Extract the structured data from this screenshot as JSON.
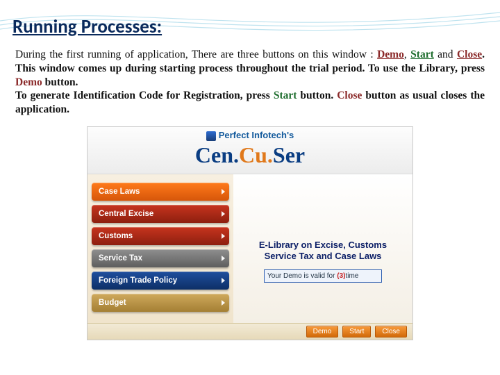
{
  "heading": "Running Processes:",
  "para": {
    "seg1": "During the first running of application, There are three buttons on this window : ",
    "demo": "Demo",
    "comma": ", ",
    "start": "Start",
    "and": " and ",
    "close": "Close",
    "seg2": ".  This window comes up during starting process throughout the trial period.  To use the Library, press ",
    "demo2": "Demo",
    "seg3": " button.",
    "line2a": "To generate Identification Code for Registration, press ",
    "start2": "Start",
    "line2b": " button. ",
    "close2": "Close",
    "line2c": " button as usual closes the application."
  },
  "app": {
    "brand_top": "Perfect Infotech's",
    "brand_main_pre": "Cen.",
    "brand_main_mid": "Cu.",
    "brand_main_post": "Ser",
    "menu": [
      {
        "label": "Case Laws",
        "cls": "mi-orange"
      },
      {
        "label": "Central Excise",
        "cls": "mi-red"
      },
      {
        "label": "Customs",
        "cls": "mi-red"
      },
      {
        "label": "Service Tax",
        "cls": "mi-grey"
      },
      {
        "label": "Foreign Trade Policy",
        "cls": "mi-blue"
      },
      {
        "label": "Budget",
        "cls": "mi-tan"
      }
    ],
    "elib_line1": "E-Library on Excise, Customs",
    "elib_line2": "Service Tax and Case Laws",
    "trial_pre": "Your Demo is valid for ",
    "trial_num": "(3)",
    "trial_post": "time",
    "buttons": {
      "demo": "Demo",
      "start": "Start",
      "close": "Close"
    }
  }
}
